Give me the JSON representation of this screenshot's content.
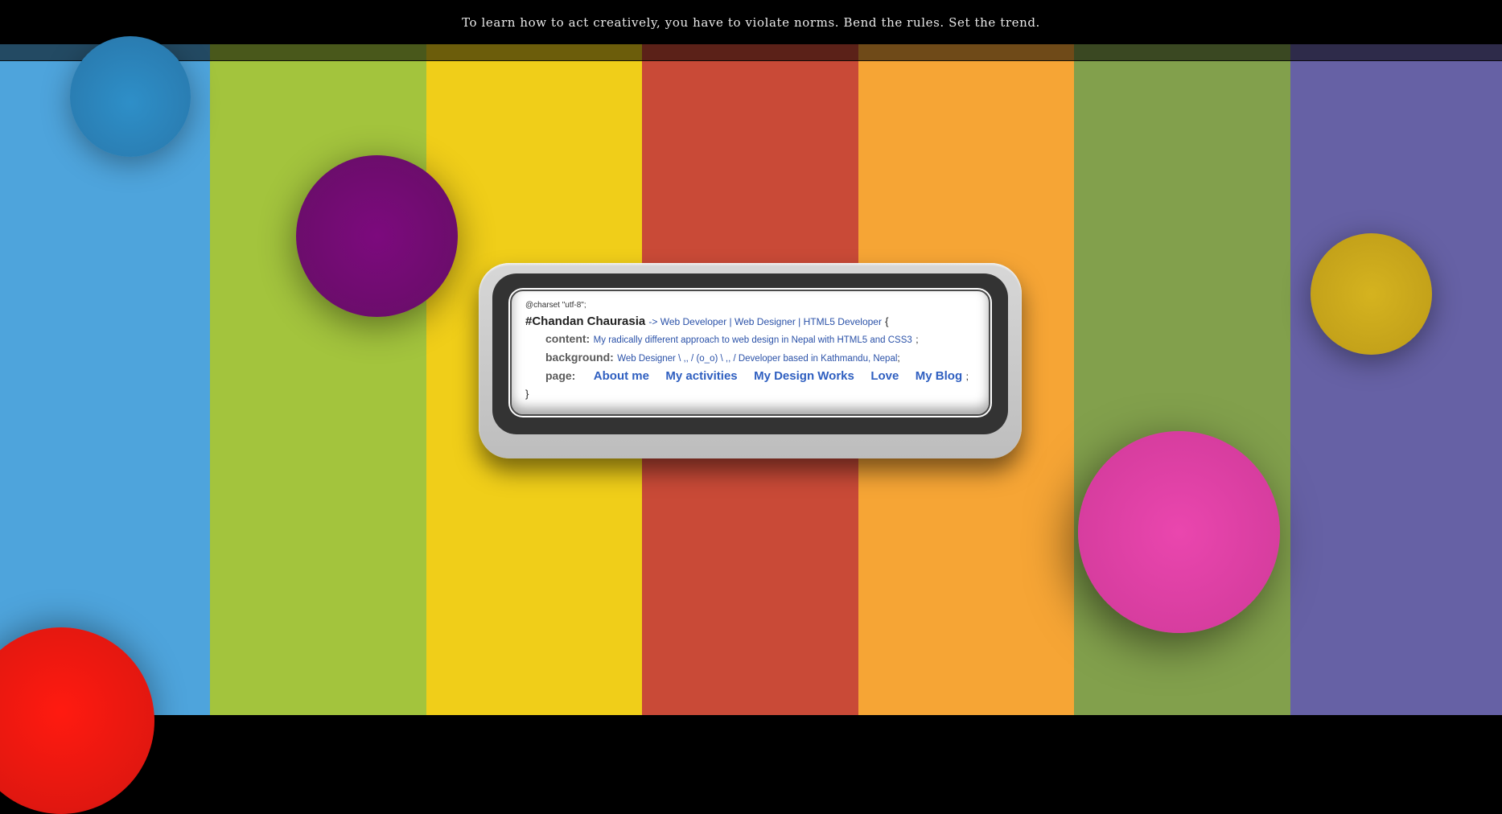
{
  "header": {
    "tagline": "To learn how to act creatively, you have to violate norms. Bend the rules. Set the trend."
  },
  "colors": {
    "stripes": [
      "#4ea4dc",
      "#a3c43d",
      "#f0ce19",
      "#c94a37",
      "#f6a535",
      "#82a04c",
      "#6661a5"
    ],
    "balls": [
      "#2a7db2",
      "#6c0d6c",
      "#c4a21a",
      "#d73d9f",
      "#e11710"
    ],
    "link": "#2f5fc0"
  },
  "card": {
    "charset": "@charset \"utf-8\";",
    "hash": "#",
    "name": "Chandan Chaurasia",
    "subtitle": "-> Web Developer | Web Designer | HTML5 Developer",
    "open_brace": "{",
    "content_key": "content:",
    "content_value": "My radically different approach to web design in Nepal with HTML5 and CSS3",
    "content_end": ";",
    "background_key": "background:",
    "background_value": "Web Designer \\ ,, / (o_o) \\ ,, / Developer based in Kathmandu, Nepal",
    "background_end": ";",
    "page_key": "page:",
    "nav": [
      "About me",
      "My activities",
      "My Design Works",
      "Love",
      "My Blog"
    ],
    "page_end": ";",
    "close_brace": "}"
  }
}
